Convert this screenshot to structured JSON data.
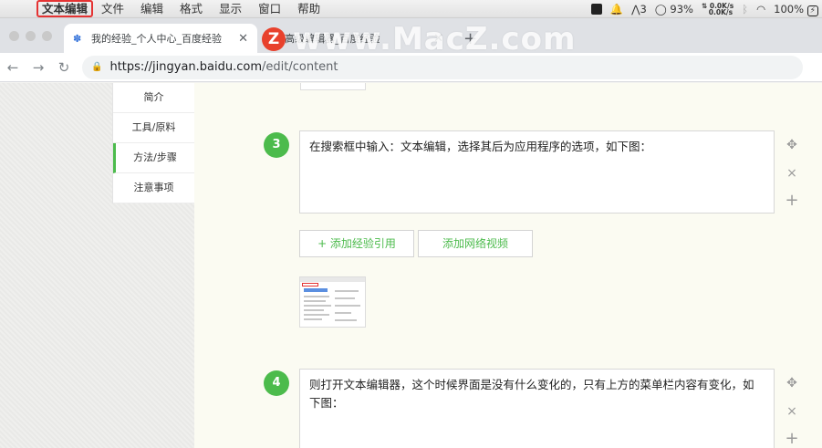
{
  "menubar": {
    "app_menu": "文本编辑",
    "items": [
      "文件",
      "编辑",
      "格式",
      "显示",
      "窗口",
      "帮助"
    ],
    "status": {
      "notification_badge": "3",
      "battery_percent": "93%",
      "net_up": "0.0K/s",
      "net_down": "0.0K/s",
      "battery_full": "100%"
    }
  },
  "browser": {
    "tabs": [
      {
        "title": "我的经验_个人中心_百度经验",
        "icon": "baidu-paw-icon"
      },
      {
        "title": "高级编辑器_百度经验",
        "icon": "doc-icon"
      }
    ],
    "url_main": "https://jingyan.baidu.com",
    "url_path": "/edit/content",
    "watermark": "www.MacZ.com",
    "watermark_logo": "Z"
  },
  "sidenav": {
    "items": [
      "简介",
      "工具/原料",
      "方法/步骤",
      "注意事项"
    ],
    "active_index": 2
  },
  "steps": [
    {
      "number": "3",
      "text": "在搜索框中输入：文本编辑，选择其后为应用程序的选项，如下图："
    },
    {
      "number": "4",
      "text": "则打开文本编辑器，这个时候界面是没有什么变化的，只有上方的菜单栏内容有变化，如下图："
    }
  ],
  "buttons": {
    "add_reference": "+ 添加经验引用",
    "add_video": "添加网络视频"
  },
  "controls": {
    "move": "✥",
    "delete": "×",
    "add": "+"
  },
  "colors": {
    "accent_green": "#4cbb4c",
    "highlight_red": "#e53333"
  }
}
